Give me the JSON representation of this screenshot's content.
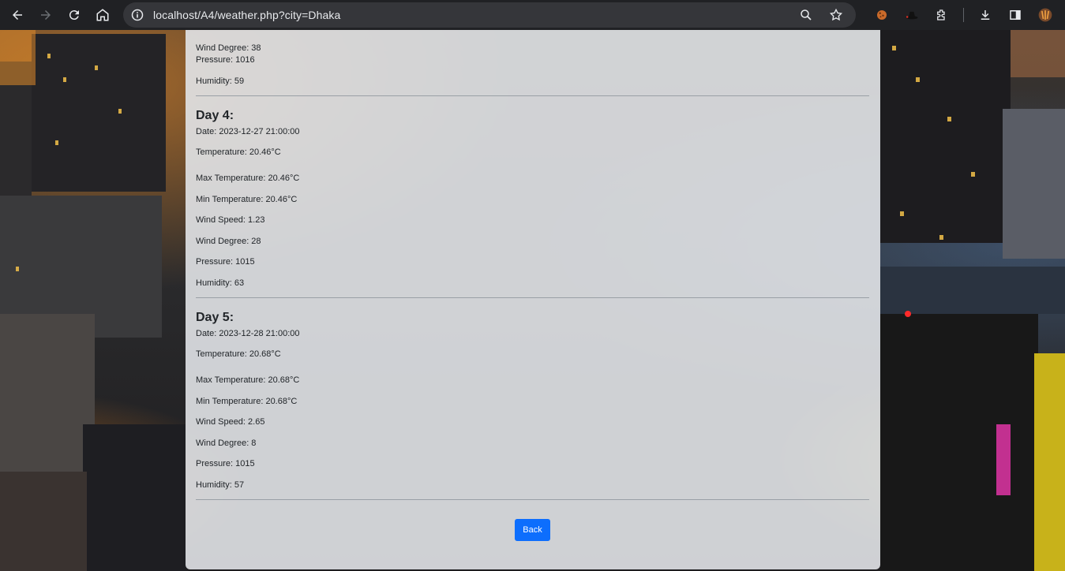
{
  "browser": {
    "url": "localhost/A4/weather.php?city=Dhaka"
  },
  "weather": {
    "partial_day": {
      "wind_degree": "Wind Degree: 38",
      "pressure": "Pressure: 1016",
      "humidity": "Humidity: 59"
    },
    "days": [
      {
        "title": "Day 4:",
        "date": "Date: 2023-12-27 21:00:00",
        "temperature": "Temperature: 20.46°C",
        "max_temperature": "Max Temperature: 20.46°C",
        "min_temperature": "Min Temperature: 20.46°C",
        "wind_speed": "Wind Speed: 1.23",
        "wind_degree": "Wind Degree: 28",
        "pressure": "Pressure: 1015",
        "humidity": "Humidity: 63"
      },
      {
        "title": "Day 5:",
        "date": "Date: 2023-12-28 21:00:00",
        "temperature": "Temperature: 20.68°C",
        "max_temperature": "Max Temperature: 20.68°C",
        "min_temperature": "Min Temperature: 20.68°C",
        "wind_speed": "Wind Speed: 2.65",
        "wind_degree": "Wind Degree: 8",
        "pressure": "Pressure: 1015",
        "humidity": "Humidity: 57"
      }
    ],
    "back_label": "Back"
  },
  "colors": {
    "button_primary": "#0d6efd",
    "panel_bg": "#e2e4e8"
  }
}
